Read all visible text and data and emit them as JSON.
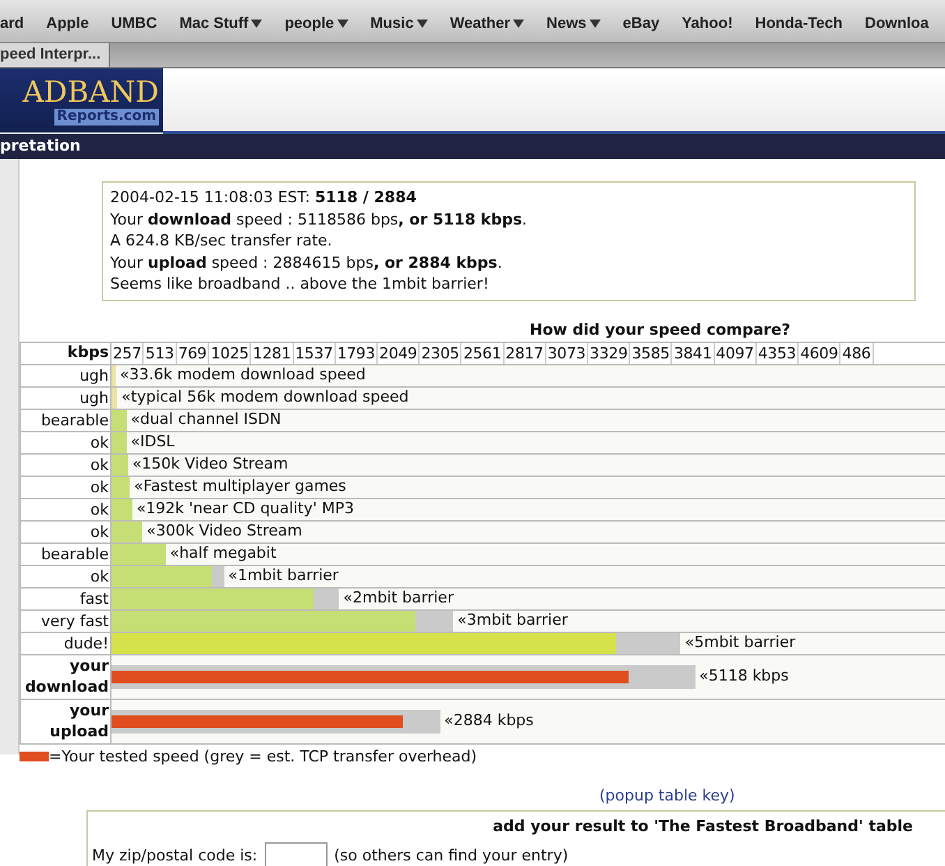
{
  "bookmarks": [
    {
      "label": "ard",
      "menu": false
    },
    {
      "label": "Apple",
      "menu": false
    },
    {
      "label": "UMBC",
      "menu": false
    },
    {
      "label": "Mac Stuff",
      "menu": true
    },
    {
      "label": "people",
      "menu": true
    },
    {
      "label": "Music",
      "menu": true
    },
    {
      "label": "Weather",
      "menu": true
    },
    {
      "label": "News",
      "menu": true
    },
    {
      "label": "eBay",
      "menu": false
    },
    {
      "label": "Yahoo!",
      "menu": false
    },
    {
      "label": "Honda-Tech",
      "menu": false
    },
    {
      "label": "Downloa",
      "menu": false
    }
  ],
  "tab": {
    "title": "peed Interpr..."
  },
  "logo": {
    "title": "ADBAND",
    "subtitle": "Reports.com"
  },
  "nav": {
    "title": "pretation"
  },
  "summary": [
    "2004-02-15 11:08:03 EST: **5118 / 2884**",
    "Your **download** speed : 5118586 bps**, or 5118 kbps**.",
    "A 624.8 KB/sec transfer rate.",
    "Your **upload** speed : 2884615 bps**, or 2884 kbps**.",
    "Seems like broadband .. above the 1mbit barrier!"
  ],
  "compare_title": "How did your speed compare?",
  "axis": {
    "label": "kbps",
    "ticks": [
      "257",
      "513",
      "769",
      "1025",
      "1281",
      "1537",
      "1793",
      "2049",
      "2305",
      "2561",
      "2817",
      "3073",
      "3329",
      "3585",
      "3841",
      "4097",
      "4353",
      "4609",
      "486"
    ]
  },
  "rows": [
    {
      "kind": "reference",
      "rating": "ugh",
      "label": "«33.6k modem download speed",
      "color": "#e9e4a2",
      "level": 0.005
    },
    {
      "kind": "reference",
      "rating": "ugh",
      "label": "«typical 56k modem download speed",
      "color": "#e9e4a2",
      "level": 0.007
    },
    {
      "kind": "reference",
      "rating": "bearable",
      "label": "«dual channel ISDN",
      "color": "#c6df74",
      "level": 0.018
    },
    {
      "kind": "reference",
      "rating": "ok",
      "label": "«IDSL",
      "color": "#c6df74",
      "level": 0.018
    },
    {
      "kind": "reference",
      "rating": "ok",
      "label": "«150k Video Stream",
      "color": "#c6df74",
      "level": 0.02
    },
    {
      "kind": "reference",
      "rating": "ok",
      "label": "«Fastest multiplayer games",
      "color": "#c6df74",
      "level": 0.022
    },
    {
      "kind": "reference",
      "rating": "ok",
      "label": "«192k 'near CD quality' MP3",
      "color": "#c6df74",
      "level": 0.025
    },
    {
      "kind": "reference",
      "rating": "ok",
      "label": "«300k Video Stream",
      "color": "#c6df74",
      "level": 0.037
    },
    {
      "kind": "reference",
      "rating": "bearable",
      "label": "«half megabit",
      "color": "#c6df74",
      "level": 0.065
    },
    {
      "kind": "reference",
      "rating": "ok",
      "label": "«1mbit barrier",
      "color": "#c6df74",
      "level": 0.12,
      "overhead": {
        "level": 0.135
      }
    },
    {
      "kind": "reference",
      "rating": "fast",
      "label": "«2mbit barrier",
      "color": "#c6df74",
      "level": 0.243,
      "overhead": {
        "level": 0.273
      }
    },
    {
      "kind": "reference",
      "rating": "very fast",
      "label": "«3mbit barrier",
      "color": "#c6df74",
      "level": 0.365,
      "overhead": {
        "level": 0.41
      }
    },
    {
      "kind": "reference",
      "rating": "dude!",
      "label": "«5mbit barrier",
      "color": "#d5e24a",
      "level": 0.606,
      "overhead": {
        "level": 0.683
      }
    },
    {
      "kind": "result",
      "rating": "your download",
      "label": "«5118 kbps",
      "color": "#e04d1f",
      "level": 0.621,
      "overhead": {
        "level": 0.7
      }
    },
    {
      "kind": "result",
      "rating": "your upload",
      "label": "«2884 kbps",
      "color": "#e04d1f",
      "level": 0.35,
      "overhead": {
        "level": 0.394
      }
    }
  ],
  "legend": {
    "color": "#e04d1f",
    "text": "=Your tested speed (grey = est. TCP transfer overhead)"
  },
  "popup_link": "(popup table key)",
  "form": {
    "title": "add your result to 'The Fastest Broadband' table",
    "zip_label": "My zip/postal code is:",
    "zip_hint": "(so others can find your entry)"
  }
}
